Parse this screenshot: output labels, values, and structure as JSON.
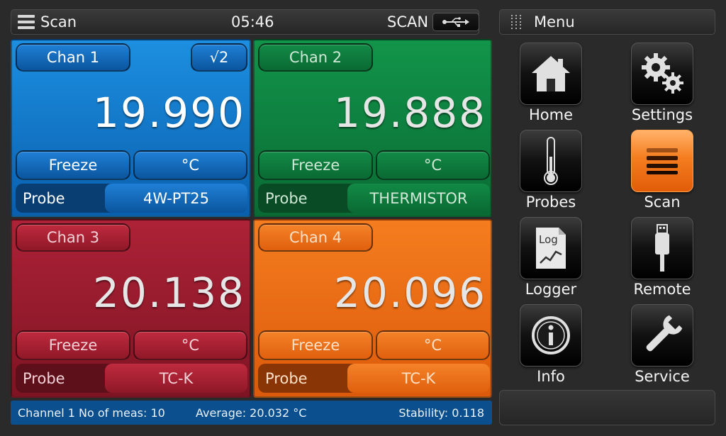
{
  "topbar": {
    "title": "Scan",
    "time": "05:46",
    "mode": "SCAN",
    "usb_icon": "usb-icon"
  },
  "menubar": {
    "title": "Menu"
  },
  "channels": [
    {
      "chan_label": "Chan 1",
      "sqrt_label": "√2",
      "reading": "19.990",
      "freeze_label": "Freeze",
      "unit": "°C",
      "probe_label": "Probe",
      "probe_value": "4W-PT25",
      "color": "#1d8fe0"
    },
    {
      "chan_label": "Chan 2",
      "reading": "19.888",
      "freeze_label": "Freeze",
      "unit": "°C",
      "probe_label": "Probe",
      "probe_value": "THERMISTOR",
      "color": "#12944a"
    },
    {
      "chan_label": "Chan 3",
      "reading": "20.138",
      "freeze_label": "Freeze",
      "unit": "°C",
      "probe_label": "Probe",
      "probe_value": "TC-K",
      "color": "#ad2237"
    },
    {
      "chan_label": "Chan 4",
      "reading": "20.096",
      "freeze_label": "Freeze",
      "unit": "°C",
      "probe_label": "Probe",
      "probe_value": "TC-K",
      "color": "#f57d1f"
    }
  ],
  "status": {
    "channel_meas": "Channel 1 No of meas: 10",
    "average": "Average: 20.032 °C",
    "stability": "Stability: 0.118"
  },
  "menu": [
    {
      "label": "Home",
      "icon": "home-icon"
    },
    {
      "label": "Settings",
      "icon": "gears-icon"
    },
    {
      "label": "Probes",
      "icon": "thermometer-icon"
    },
    {
      "label": "Scan",
      "icon": "scan-list-icon",
      "active": true
    },
    {
      "label": "Logger",
      "icon": "log-file-icon",
      "icon_text": "Log"
    },
    {
      "label": "Remote",
      "icon": "usb-plug-icon"
    },
    {
      "label": "Info",
      "icon": "info-icon"
    },
    {
      "label": "Service",
      "icon": "wrench-icon"
    }
  ]
}
